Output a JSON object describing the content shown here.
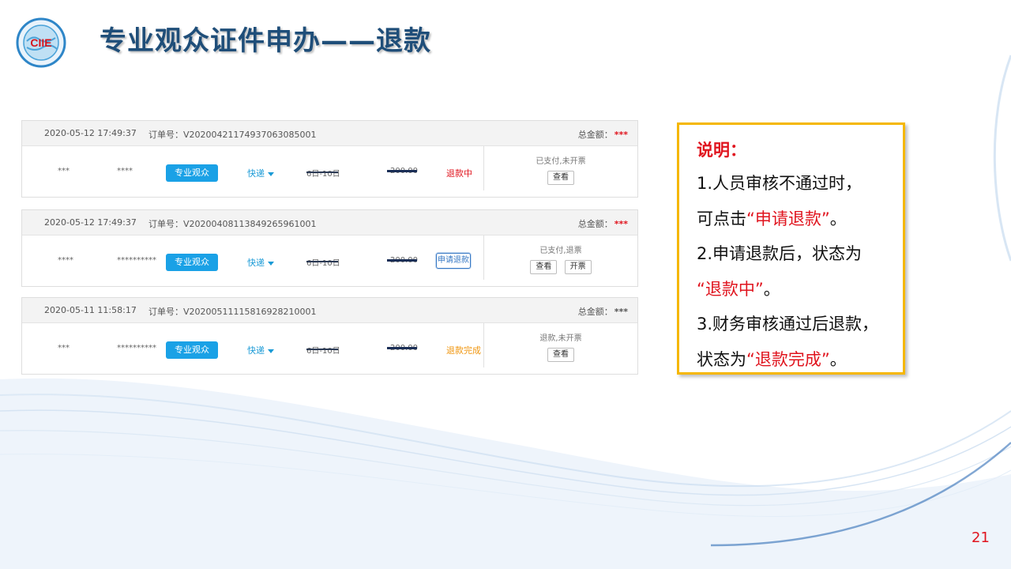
{
  "header": {
    "title": "专业观众证件申办——退款",
    "logo_text": "CIIE"
  },
  "orders": [
    {
      "date": "2020-05-12 17:49:37",
      "order_no": "订单号：V20200421174937063085001",
      "total_label": "总金额：",
      "total_value": "***",
      "name": "***",
      "id": "****",
      "type_button": "专业观众",
      "delivery": "快递",
      "date_masked": "6日-10日",
      "price_masked": "200.00",
      "status": "退款中",
      "pay_state": "已支付,未开票",
      "buttons": [
        "查看"
      ]
    },
    {
      "date": "2020-05-12 17:49:37",
      "order_no": "订单号：V20200408113849265961001",
      "total_label": "总金额：",
      "total_value": "***",
      "name": "****",
      "id": "**********",
      "type_button": "专业观众",
      "delivery": "快递",
      "date_masked": "6日-10日",
      "price_masked": "200.00",
      "refund_button": "申请退款",
      "pay_state": "已支付,退票",
      "buttons": [
        "查看",
        "开票"
      ]
    },
    {
      "date": "2020-05-11 11:58:17",
      "order_no": "订单号：V20200511115816928210001",
      "total_label": "总金额：",
      "total_value": "***",
      "name": "***",
      "id": "**********",
      "type_button": "专业观众",
      "delivery": "快递",
      "date_masked": "6日-10日",
      "price_masked": "200.00",
      "status": "退款完成",
      "pay_state": "退款,未开票",
      "buttons": [
        "查看"
      ]
    }
  ],
  "note": {
    "heading": "说明：",
    "line1": "1.人员审核不通过时，",
    "line2_pre": "可点击",
    "line2_red": "“申请退款”",
    "line2_post": "。",
    "line3": "2.申请退款后，状态为",
    "line4_red": "“退款中”",
    "line4_post": "。",
    "line5": "3.财务审核通过后退款，",
    "line6_pre": "状态为",
    "line6_red": "“退款完成”",
    "line6_post": "。"
  },
  "page_number": "21",
  "colors": {
    "title": "#1f4e79",
    "accent_red": "#e0141e",
    "type_button": "#1aa1e6",
    "note_border": "#f5b700",
    "status_done": "#f0960f"
  }
}
